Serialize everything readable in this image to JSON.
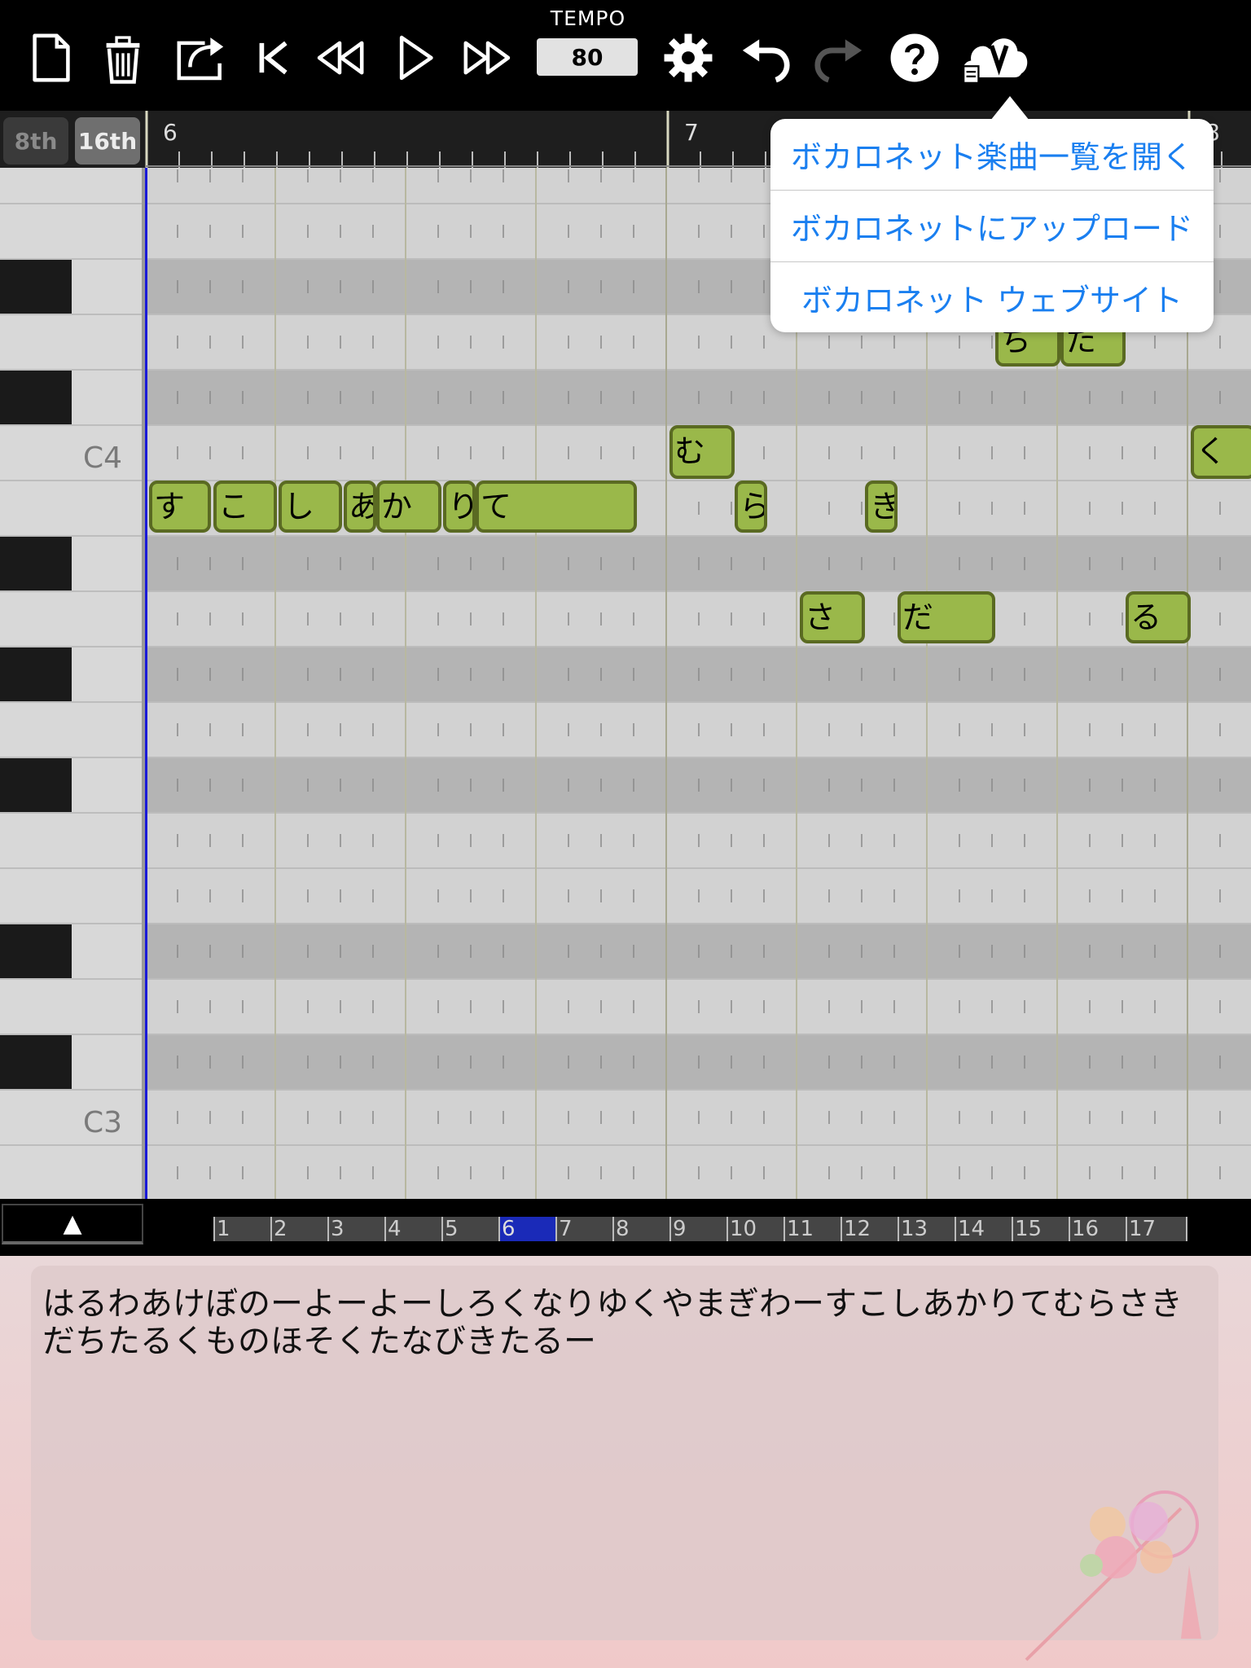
{
  "toolbar": {
    "tempo_label": "TEMPO",
    "tempo_value": "80",
    "icons": [
      "new-file-icon",
      "trash-icon",
      "share-icon",
      "skip-to-start-icon",
      "rewind-icon",
      "play-icon",
      "fast-forward-icon",
      "settings-gear-icon",
      "undo-icon",
      "redo-icon",
      "help-icon",
      "vocalonet-cloud-icon"
    ]
  },
  "resolution": {
    "option_8th": "8th",
    "option_16th": "16th",
    "selected": "16th"
  },
  "ruler": {
    "measures": [
      "6",
      "7",
      "8"
    ]
  },
  "piano_keys": {
    "label_c4": "C4",
    "label_c3": "C3"
  },
  "notes": [
    "す",
    "こ",
    "し",
    "あ",
    "か",
    "り",
    "て",
    "む",
    "ら",
    "さ",
    "き",
    "だ",
    "ち",
    "た",
    "る",
    "く"
  ],
  "overview": {
    "measures": [
      "1",
      "2",
      "3",
      "4",
      "5",
      "6",
      "7",
      "8",
      "9",
      "10",
      "11",
      "12",
      "13",
      "14",
      "15",
      "16",
      "17"
    ],
    "current": "6"
  },
  "expand_button": "▲",
  "lyrics": "はるわあけぼのーよーよーしろくなりゆくやまぎわーすこしあかりてむらさきだちたるくものほそくたなびきたるー",
  "vocalonet_menu": {
    "items": [
      "ボカロネット楽曲一覧を開く",
      "ボカロネットにアップロード",
      "ボカロネット ウェブサイト"
    ]
  },
  "colors": {
    "note_fill": "#9ab84a",
    "note_border": "#5a6a22",
    "playhead": "#1a1ad8",
    "menu_text": "#1a7ff0",
    "overview_current": "#1a2ab8"
  }
}
